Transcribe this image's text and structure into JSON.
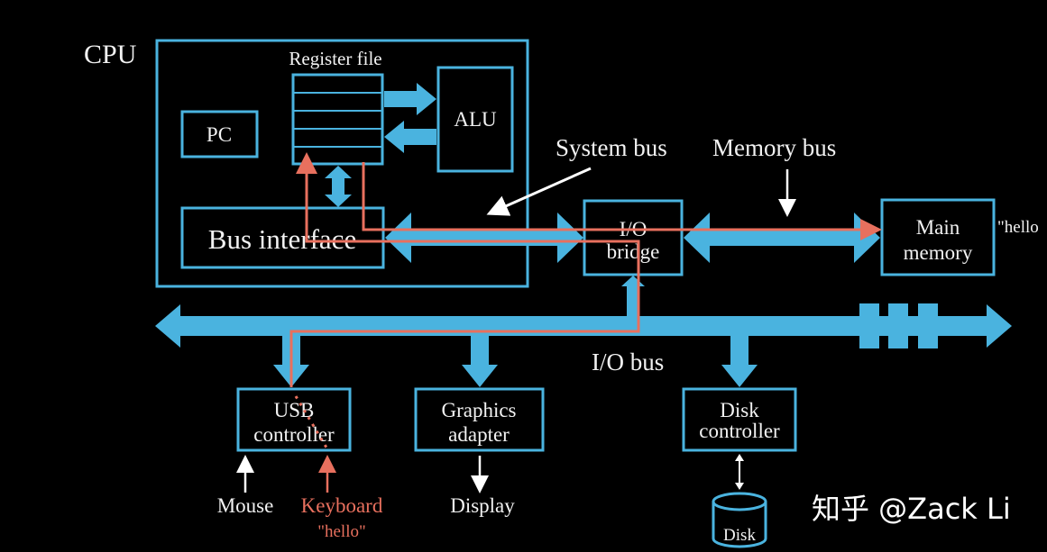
{
  "labels": {
    "cpu": "CPU",
    "register_file": "Register file",
    "alu": "ALU",
    "pc": "PC",
    "bus_interface": "Bus interface",
    "system_bus": "System bus",
    "memory_bus": "Memory bus",
    "io_bridge_line1": "I/O",
    "io_bridge_line2": "bridge",
    "main_memory_line1": "Main",
    "main_memory_line2": "memory",
    "memory_content": "\"hello",
    "io_bus": "I/O bus",
    "usb_line1": "USB",
    "usb_line2": "controller",
    "graphics_line1": "Graphics",
    "graphics_line2": "adapter",
    "disk_ctrl_line1": "Disk",
    "disk_ctrl_line2": "controller",
    "mouse": "Mouse",
    "keyboard": "Keyboard",
    "keyboard_input": "\"hello\"",
    "display": "Display",
    "disk": "Disk"
  },
  "watermark": "知乎 @Zack Li",
  "colors": {
    "bus": "#4ab3df",
    "data_path": "#e8705e",
    "text": "#f2f2f2",
    "background": "#000000"
  }
}
